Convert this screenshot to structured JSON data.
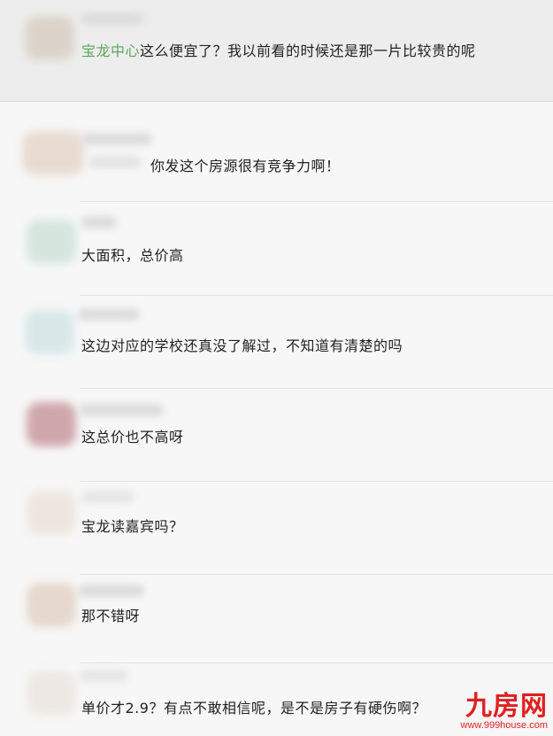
{
  "comments": [
    {
      "mention": "宝龙中心",
      "text": "这么便宜了？我以前看的时候还是那一片比较贵的呢"
    },
    {
      "text": "你发这个房源很有竞争力啊！"
    },
    {
      "text": "大面积，总价高"
    },
    {
      "text": "这边对应的学校还真没了解过，不知道有清楚的吗"
    },
    {
      "text": "这总价也不高呀"
    },
    {
      "text": "宝龙读嘉宾吗？"
    },
    {
      "text": "那不错呀"
    },
    {
      "text": "单价才2.9？有点不敢相信呢，是不是房子有硬伤啊？"
    }
  ],
  "watermark": {
    "main": "九房网",
    "sub": "www.999house.com"
  },
  "colors": {
    "mention": "#5ba75b",
    "watermark": "#e02020"
  }
}
